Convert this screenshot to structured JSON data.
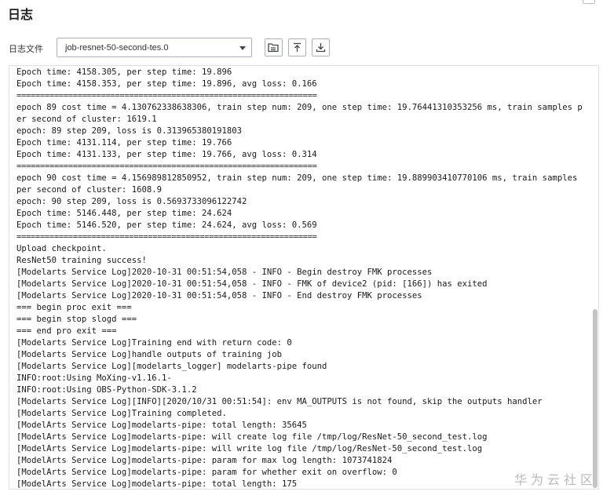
{
  "page": {
    "title": "日志"
  },
  "toolbar": {
    "log_file_label": "日志文件",
    "selected_log_file": "job-resnet-50-second-tes.0",
    "buttons": [
      {
        "icon": "open-folder-icon",
        "name": "open-log-button"
      },
      {
        "icon": "upload-icon",
        "name": "scroll-top-button"
      },
      {
        "icon": "download-icon",
        "name": "download-log-button"
      }
    ]
  },
  "log": {
    "lines": [
      "Epoch time: 4158.305, per step time: 19.896",
      "Epoch time: 4158.353, per step time: 19.896, avg loss: 0.166",
      "================================================================",
      "epoch 89 cost time = 4.130762338638306, train step num: 209, one step time: 19.76441310353256 ms, train samples per second of cluster: 1619.1",
      "epoch: 89 step 209, loss is 0.31396538019180З",
      "Epoch time: 4131.114, per step time: 19.766",
      "Epoch time: 4131.133, per step time: 19.766, avg loss: 0.314",
      "================================================================",
      "epoch 90 cost time = 4.156989812850952, train step num: 209, one step time: 19.889903410770106 ms, train samples per second of cluster: 1608.9",
      "epoch: 90 step 209, loss is 0.5693733096122742",
      "Epoch time: 5146.448, per step time: 24.624",
      "Epoch time: 5146.520, per step time: 24.624, avg loss: 0.569",
      "================================================================",
      "Upload checkpoint.",
      "ResNet50 training success!",
      "[Modelarts Service Log]2020-10-31 00:51:54,058 - INFO - Begin destroy FMK processes",
      "[Modelarts Service Log]2020-10-31 00:51:54,058 - INFO - FMK of device2 (pid: [166]) has exited",
      "[Modelarts Service Log]2020-10-31 00:51:54,058 - INFO - End destroy FMK processes",
      "=== begin proc exit ===",
      "=== begin stop slogd ===",
      "=== end pro exit ===",
      "[Modelarts Service Log]Training end with return code: 0",
      "[Modelarts Service Log]handle outputs of training job",
      "[Modelarts Service Log][modelarts_logger] modelarts-pipe found",
      "INFO:root:Using MoXing-v1.16.1-",
      "INFO:root:Using OBS-Python-SDK-3.1.2",
      "[Modelarts Service Log][INFO][2020/10/31 00:51:54]: env MA_OUTPUTS is not found, skip the outputs handler",
      "[Modelarts Service Log]Training completed.",
      "[ModelArts Service Log]modelarts-pipe: total length: 35645",
      "[ModelArts Service Log]modelarts-pipe: will create log file /tmp/log/ResNet-50_second_test.log",
      "[ModelArts Service Log]modelarts-pipe: will write log file /tmp/log/ResNet-50_second_test.log",
      "[ModelArts Service Log]modelarts-pipe: param for max log length: 1073741824",
      "[ModelArts Service Log]modelarts-pipe: param for whether exit on overflow: 0",
      "[ModelArts Service Log]modelarts-pipe: total length: 175"
    ]
  },
  "watermark": "华为云社区"
}
